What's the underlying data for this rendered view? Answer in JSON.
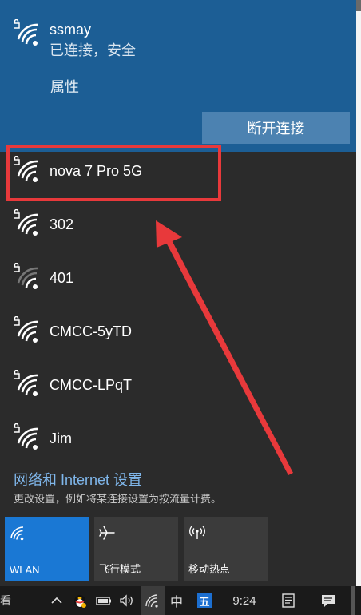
{
  "connected": {
    "name": "ssmay",
    "status": "已连接，安全",
    "properties_label": "属性",
    "disconnect_label": "断开连接"
  },
  "networks": [
    {
      "name": "nova 7 Pro 5G",
      "secured": true,
      "signal": 4
    },
    {
      "name": "302",
      "secured": true,
      "signal": 4
    },
    {
      "name": "401",
      "secured": true,
      "signal": 2
    },
    {
      "name": "CMCC-5yTD",
      "secured": true,
      "signal": 4
    },
    {
      "name": "CMCC-LPqT",
      "secured": true,
      "signal": 4
    },
    {
      "name": "Jim",
      "secured": true,
      "signal": 4
    }
  ],
  "settings": {
    "link": "网络和 Internet 设置",
    "description": "更改设置，例如将某连接设置为按流量计费。"
  },
  "tiles": [
    {
      "label": "WLAN",
      "icon": "wifi-icon",
      "active": true
    },
    {
      "label": "飞行模式",
      "icon": "airplane-icon",
      "active": false
    },
    {
      "label": "移动热点",
      "icon": "hotspot-icon",
      "active": false
    }
  ],
  "taskbar": {
    "left_fragment": "看",
    "ime_char": "中",
    "ime_badge": "五",
    "time": "9:24"
  },
  "colors": {
    "connected_bg": "#1c5e95",
    "flyout_bg": "#2b2b2b",
    "accent": "#1a78d4",
    "link": "#7fb6ea",
    "annotation": "#e8393b"
  }
}
